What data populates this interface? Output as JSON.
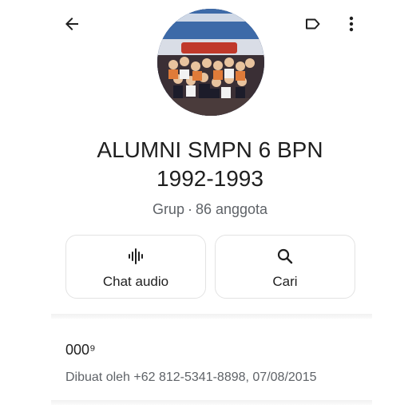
{
  "topbar": {
    "back_icon": "arrow-back-icon",
    "label_icon": "label-outline-icon",
    "more_icon": "more-vert-icon"
  },
  "group": {
    "name_line1": "ALUMNI SMPN 6 BPN",
    "name_line2": "1992-1993",
    "type": "Grup",
    "separator": "·",
    "members": "86 anggota"
  },
  "actions": {
    "audio_label": "Chat audio",
    "audio_icon": "audio-waveform-icon",
    "search_label": "Cari",
    "search_icon": "search-icon"
  },
  "description": {
    "title": "000⁹",
    "created": "Dibuat oleh +62 812-5341-8898, 07/08/2015"
  },
  "colors": {
    "text": "#1f1f1f",
    "secondary": "#5f6368",
    "card_border": "#e3e3e3"
  }
}
